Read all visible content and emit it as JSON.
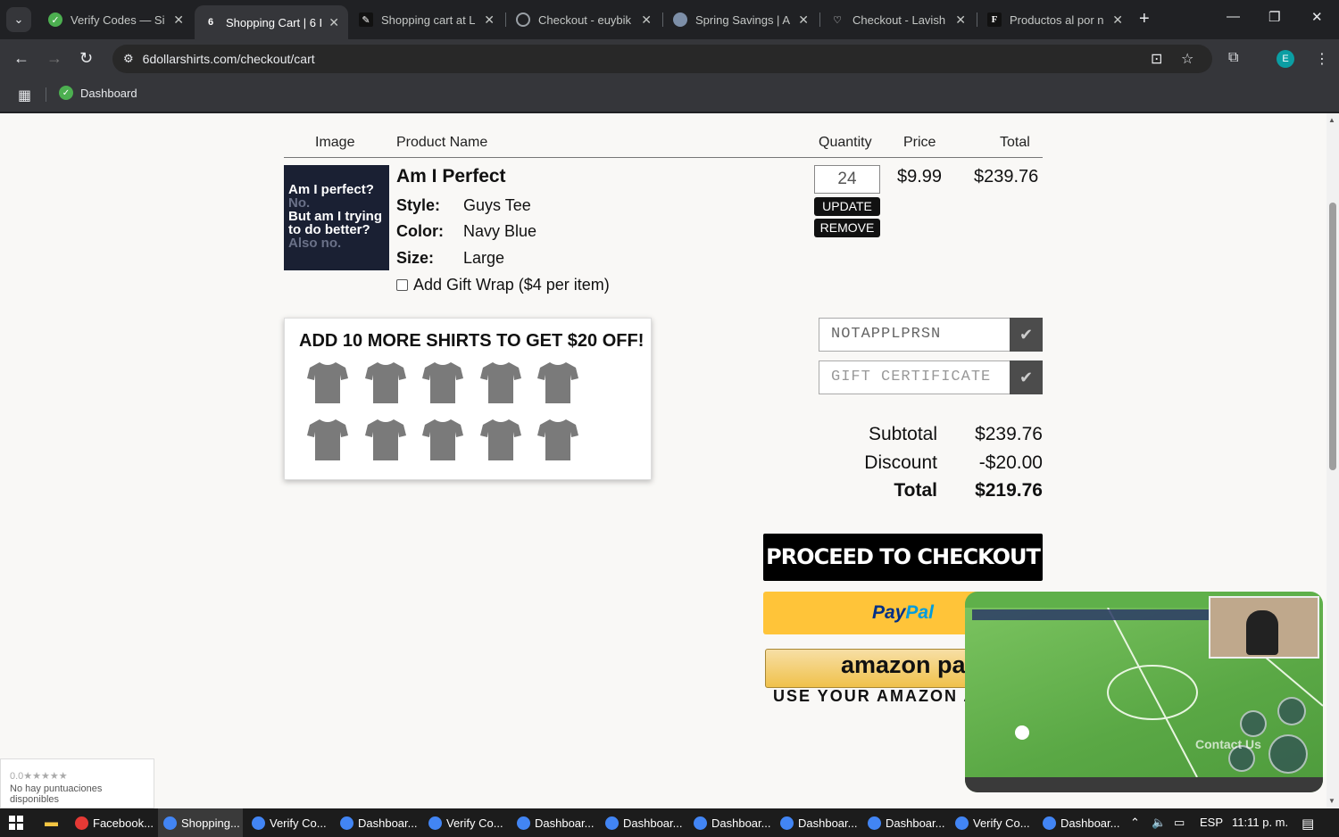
{
  "browser": {
    "tabs": [
      {
        "title": "Verify Codes — Si",
        "favicon_color": "#4caf50",
        "active": false
      },
      {
        "title": "Shopping Cart | 6 I",
        "favicon_color": "#202124",
        "active": true
      },
      {
        "title": "Shopping cart at L",
        "favicon_color": "#202124",
        "active": false
      },
      {
        "title": "Checkout - euybik",
        "favicon_color": "#9aa0a6",
        "active": false
      },
      {
        "title": "Spring Savings | A",
        "favicon_color": "#7d8fa8",
        "active": false
      },
      {
        "title": "Checkout - Lavish",
        "favicon_color": "#202124",
        "active": false
      },
      {
        "title": "Productos al por n",
        "favicon_color": "#111111",
        "active": false
      }
    ],
    "url": "6dollarshirts.com/checkout/cart",
    "profile_initial": "E",
    "bookmarks": [
      {
        "label": "Dashboard"
      }
    ]
  },
  "cart": {
    "headers": {
      "image": "Image",
      "product_name": "Product Name",
      "quantity": "Quantity",
      "price": "Price",
      "total": "Total"
    },
    "item": {
      "image_text": {
        "line1": "Am I perfect?",
        "line2": "No.",
        "line3": "But am I trying",
        "line4": "to do better?",
        "line5": "Also no."
      },
      "name": "Am I Perfect",
      "style_label": "Style:",
      "style_value": "Guys Tee",
      "color_label": "Color:",
      "color_value": "Navy Blue",
      "size_label": "Size:",
      "size_value": "Large",
      "gift_wrap_label": "Add Gift Wrap ($4 per item)",
      "gift_wrap_checked": false,
      "quantity": "24",
      "update_label": "UPDATE",
      "remove_label": "REMOVE",
      "price": "$9.99",
      "total": "$239.76"
    },
    "promo": {
      "title": "ADD 10 MORE SHIRTS TO GET $20 OFF!",
      "shirt_count": 10,
      "shirt_color": "#7a7a7a"
    },
    "coupon": {
      "value": "NOTAPPLPRSN"
    },
    "gift_certificate": {
      "placeholder": "GIFT CERTIFICATE"
    },
    "summary": {
      "subtotal_label": "Subtotal",
      "subtotal": "$239.76",
      "discount_label": "Discount",
      "discount": "-$20.00",
      "total_label": "Total",
      "total": "$219.76"
    },
    "checkout_label": "PROCEED TO CHECKOUT",
    "paypal_label": {
      "part1": "Pay",
      "part2": "Pal"
    },
    "amazon_label": "amazon pay",
    "amazon_caption": "USE YOUR AMAZON ACCOUNT"
  },
  "rating_widget": {
    "stars": "0.0★★★★★",
    "text": "No hay puntuaciones disponibles"
  },
  "video_overlay": {
    "contact_text": "Contact Us"
  },
  "taskbar": {
    "items": [
      {
        "label": "Facebook...",
        "color": "#e53935",
        "active": false
      },
      {
        "label": "Shopping...",
        "color": "#4285f4",
        "active": true
      },
      {
        "label": "Verify Co...",
        "color": "#4285f4",
        "active": false
      },
      {
        "label": "Dashboar...",
        "color": "#4285f4",
        "active": false
      },
      {
        "label": "Verify Co...",
        "color": "#4285f4",
        "active": false
      },
      {
        "label": "Dashboar...",
        "color": "#4285f4",
        "active": false
      },
      {
        "label": "Dashboar...",
        "color": "#4285f4",
        "active": false
      },
      {
        "label": "Dashboar...",
        "color": "#4285f4",
        "active": false
      },
      {
        "label": "Dashboar...",
        "color": "#4285f4",
        "active": false
      },
      {
        "label": "Dashboar...",
        "color": "#4285f4",
        "active": false
      },
      {
        "label": "Verify Co...",
        "color": "#4285f4",
        "active": false
      },
      {
        "label": "Dashboar...",
        "color": "#4285f4",
        "active": false
      }
    ],
    "language": "ESP",
    "time": "11:11 p. m."
  }
}
